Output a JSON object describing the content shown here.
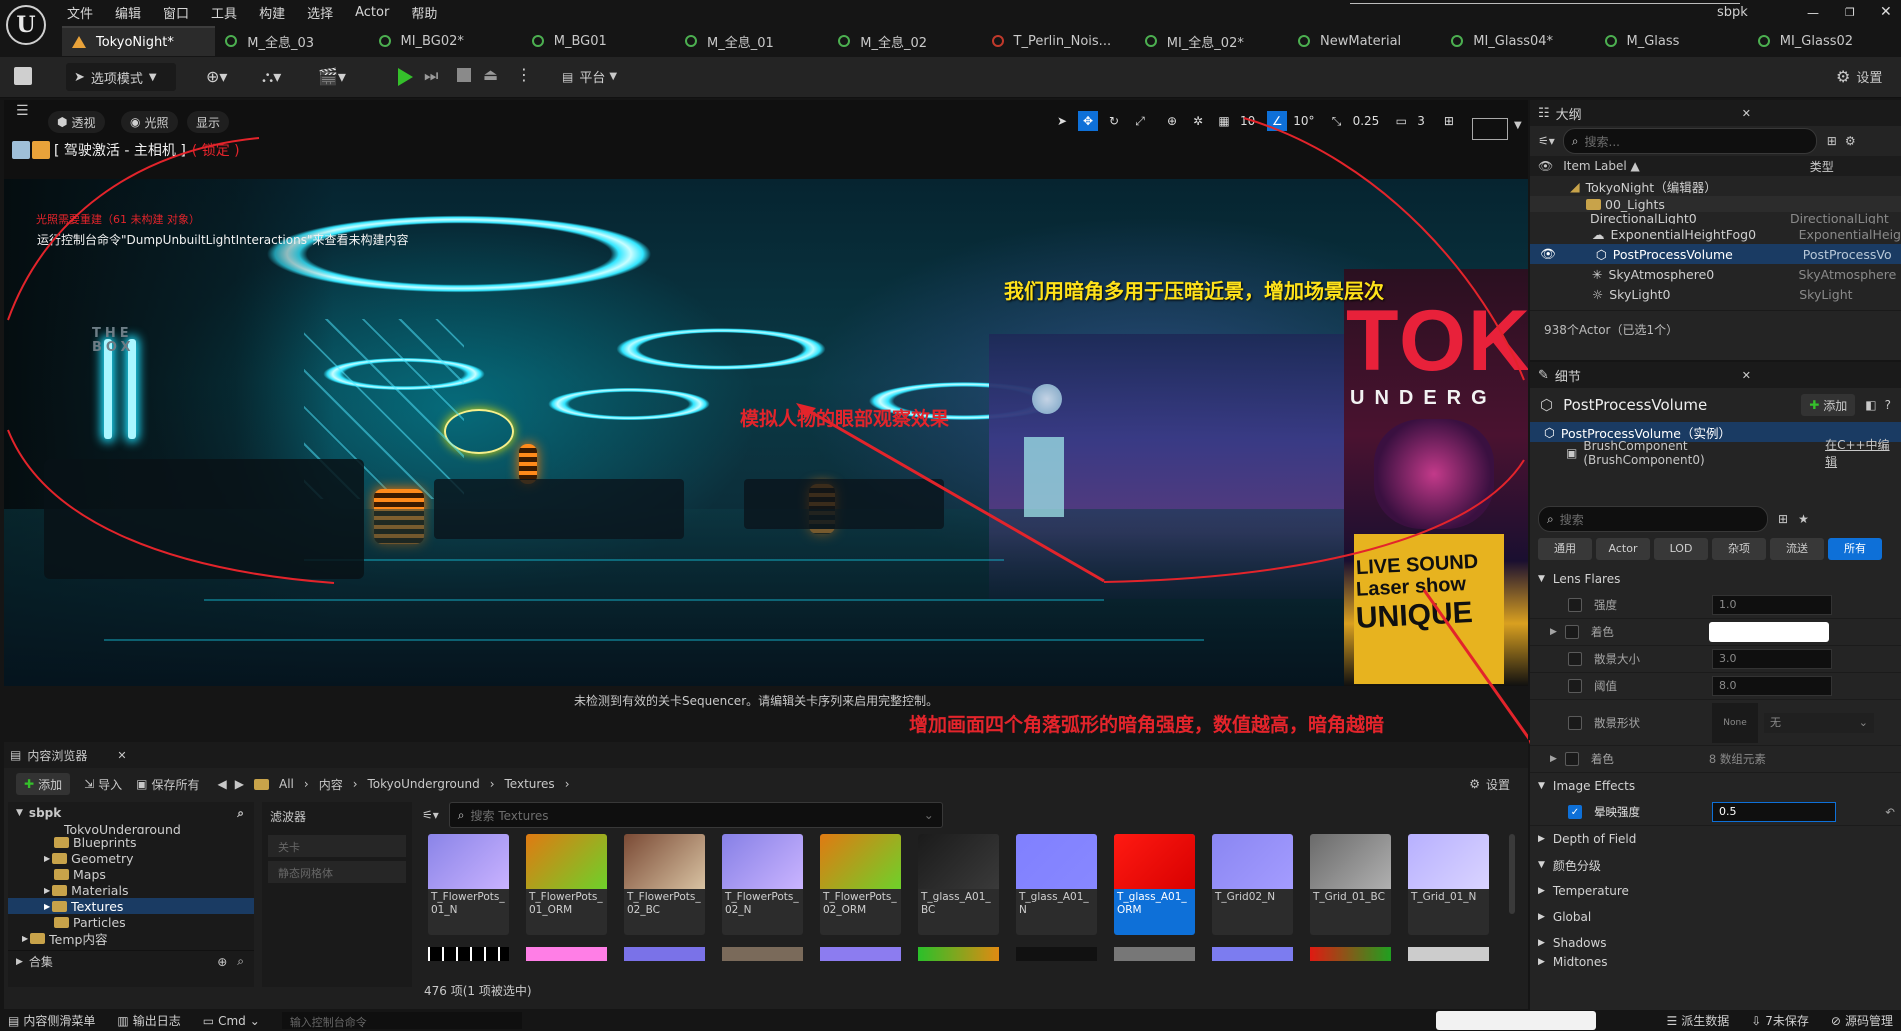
{
  "menu": {
    "items": [
      "文件",
      "编辑",
      "窗口",
      "工具",
      "构建",
      "选择",
      "Actor",
      "帮助"
    ],
    "user": "sbpk"
  },
  "tabs": [
    {
      "label": "TokyoNight*",
      "kind": "level",
      "active": true
    },
    {
      "label": "M_全息_03",
      "kind": "material"
    },
    {
      "label": "MI_BG02*",
      "kind": "material"
    },
    {
      "label": "M_BG01",
      "kind": "material"
    },
    {
      "label": "M_全息_01",
      "kind": "material"
    },
    {
      "label": "M_全息_02",
      "kind": "material"
    },
    {
      "label": "T_Perlin_Nois...",
      "kind": "texture"
    },
    {
      "label": "MI_全息_02*",
      "kind": "material"
    },
    {
      "label": "NewMaterial",
      "kind": "material"
    },
    {
      "label": "MI_Glass04*",
      "kind": "material"
    },
    {
      "label": "M_Glass",
      "kind": "material"
    },
    {
      "label": "MI_Glass02",
      "kind": "material"
    }
  ],
  "toolbar": {
    "mode_label": "选项模式",
    "platform_label": "平台",
    "settings_label": "设置"
  },
  "viewport": {
    "chips": [
      "透视",
      "光照",
      "显示"
    ],
    "title": "[ 驾驶激活 - 主相机 ]",
    "locked": "( 锁定 )",
    "snap_grid": "10",
    "snap_angle": "10°",
    "snap_scale": "0.25",
    "camera_speed": "3",
    "warn_rebuild": "光照需要重建（61 未构建 对象）",
    "warn_console": "运行控制台命令\"DumpUnbuiltLightInteractions\"来查看未构建内容",
    "sequencer_msg": "未检测到有效的关卡Sequencer。请编辑关卡序列来启用完整控制。",
    "poster_big": "TOKY",
    "poster_sub": "UNDERG",
    "poster_live1": "LIVE SOUND",
    "poster_live2": "Laser show",
    "poster_live3": "UNIQUE",
    "wall_text": "THE BOX"
  },
  "annotations": {
    "top": "我们用暗角多用于压暗近景，增加场景层次",
    "middle": "模拟人物的眼部观察效果",
    "bottom": "增加画面四个角落弧形的暗角强度，数值越高，暗角越暗"
  },
  "outliner": {
    "title": "大纲",
    "search_placeholder": "搜索...",
    "col_label": "Item Label ▲",
    "col_type": "类型",
    "rows": [
      {
        "label": "TokyoNight（编辑器）",
        "type": ""
      },
      {
        "label": "00_Lights",
        "type": ""
      },
      {
        "label": "DirectionalLight0",
        "type": "DirectionalLight"
      },
      {
        "label": "ExponentialHeightFog0",
        "type": "ExponentialHeig"
      },
      {
        "label": "PostProcessVolume",
        "type": "PostProcessVo",
        "selected": true
      },
      {
        "label": "SkyAtmosphere0",
        "type": "SkyAtmosphere"
      },
      {
        "label": "SkyLight0",
        "type": "SkyLight"
      }
    ],
    "count": "938个Actor（已选1个）"
  },
  "details": {
    "title": "细节",
    "object": "PostProcessVolume",
    "add_label": "添加",
    "instance": "PostProcessVolume（实例）",
    "component": "BrushComponent (BrushComponent0)",
    "cpp_link": "在C++中编辑",
    "search_placeholder": "搜索",
    "filters": [
      "通用",
      "Actor",
      "LOD",
      "杂项",
      "流送",
      "所有"
    ],
    "lens_flares": {
      "title": "Lens Flares",
      "rows": [
        {
          "label": "强度",
          "value": "1.0"
        },
        {
          "label": "着色",
          "value": ""
        },
        {
          "label": "散景大小",
          "value": "3.0"
        },
        {
          "label": "阈值",
          "value": "8.0"
        },
        {
          "label": "散景形状",
          "value": "无",
          "thumb": "None"
        },
        {
          "label": "着色",
          "value": "8 数组元素"
        }
      ]
    },
    "image_effects": {
      "title": "Image Effects",
      "vignette_label": "晕映强度",
      "vignette_value": "0.5"
    },
    "sections": [
      "Depth of Field",
      "颜色分级",
      "Temperature",
      "Global",
      "Shadows",
      "Midtones"
    ]
  },
  "content_browser": {
    "tab": "内容浏览器",
    "add": "添加",
    "import": "导入",
    "save_all": "保存所有",
    "breadcrumb": [
      "All",
      "内容",
      "TokyoUnderground",
      "Textures"
    ],
    "settings": "设置",
    "root": "sbpk",
    "tree": [
      "TokyoUnderground",
      "Blueprints",
      "Geometry",
      "Maps",
      "Materials",
      "Textures",
      "Particles",
      "Temp内容"
    ],
    "collections": "合集",
    "filter_title": "滤波器",
    "filters": [
      "关卡",
      "静态网格体"
    ],
    "search_placeholder": "搜索 Textures",
    "assets": [
      {
        "label": "T_FlowerPots_01_N",
        "c1": "#8a84e8",
        "c2": "#c9b2ff"
      },
      {
        "label": "T_FlowerPots_01_ORM",
        "c1": "#e07a12",
        "c2": "#6dd12a"
      },
      {
        "label": "T_FlowerPots_02_BC",
        "c1": "#7a4a35",
        "c2": "#d8c2a2"
      },
      {
        "label": "T_FlowerPots_02_N",
        "c1": "#8680e6",
        "c2": "#cab4ff"
      },
      {
        "label": "T_FlowerPots_02_ORM",
        "c1": "#e07a12",
        "c2": "#6ed12a"
      },
      {
        "label": "T_glass_A01_BC",
        "c1": "#1b1b1b",
        "c2": "#3a3a3a"
      },
      {
        "label": "T_glass_A01_N",
        "c1": "#8080ff",
        "c2": "#8888ff"
      },
      {
        "label": "T_glass_A01_ORM",
        "c1": "#ff1a12",
        "c2": "#d80000",
        "selected": true
      },
      {
        "label": "T_Grid02_N",
        "c1": "#8a86f2",
        "c2": "#a49cff"
      },
      {
        "label": "T_Grid_01_BC",
        "c1": "#6a6a6a",
        "c2": "#b0b0b0"
      },
      {
        "label": "T_Grid_01_N",
        "c1": "#b7b0ff",
        "c2": "#dad4ff"
      }
    ],
    "count": "476 项(1 项被选中)"
  },
  "statusbar": {
    "drawer": "内容侧滑菜单",
    "log": "输出日志",
    "cmd": "Cmd",
    "console_placeholder": "输入控制台命令",
    "derived": "派生数据",
    "unsaved": "7未保存",
    "source": "源码管理"
  },
  "colors": {
    "accent": "#0e70d8",
    "annotation_red": "#e3242b",
    "annotation_yellow": "#ffe21a",
    "neon": "#31e6ff"
  }
}
